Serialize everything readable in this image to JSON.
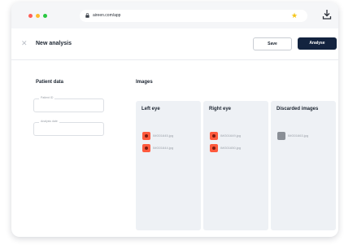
{
  "browser": {
    "url": "aireen.com/app"
  },
  "header": {
    "title": "New analysis",
    "save_label": "Save",
    "analyse_label": "Analyse"
  },
  "patient": {
    "section_title": "Patient data",
    "fields": [
      {
        "label": "Patient ID",
        "value": ""
      },
      {
        "label": "Analysis date",
        "value": ""
      }
    ]
  },
  "images": {
    "section_title": "Images",
    "columns": [
      {
        "title": "Left eye",
        "files": [
          "IMG01645.jpg",
          "IMG01644.jpg"
        ]
      },
      {
        "title": "Right eye",
        "files": [
          "IMG01649.jpg",
          "IMG01650.jpg"
        ]
      },
      {
        "title": "Discarded images",
        "files": [
          "IMG01663.jpg"
        ]
      }
    ]
  },
  "colors": {
    "primary": "#13233f",
    "eye_thumb": "#ff5a3d",
    "discarded_thumb": "#8a8f96",
    "column_bg": "#eef1f5"
  }
}
